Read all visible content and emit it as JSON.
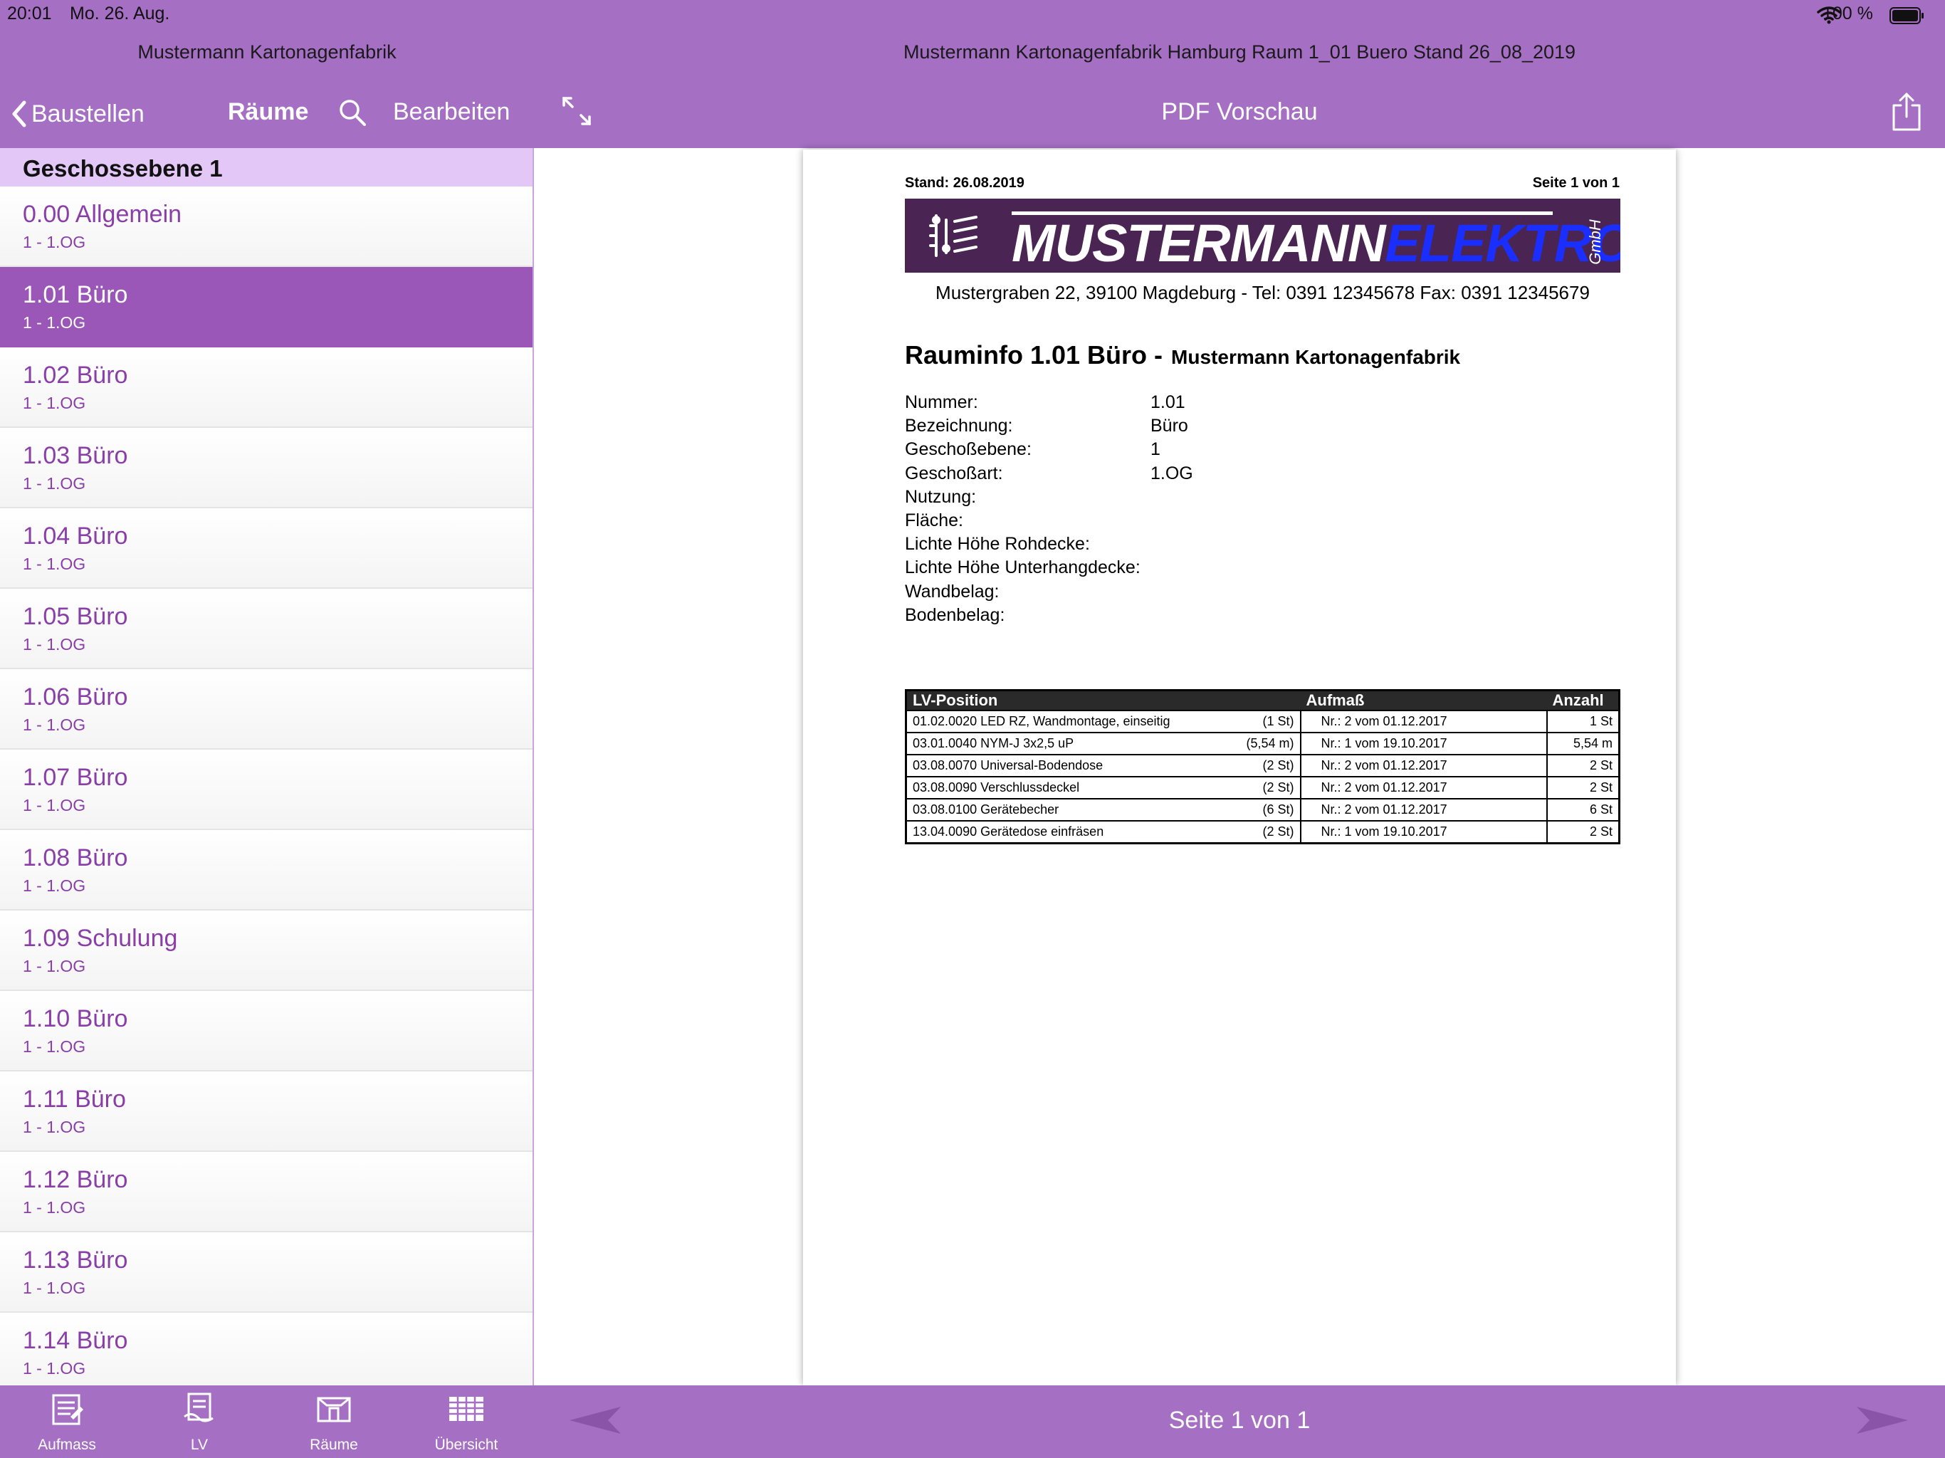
{
  "status_bar": {
    "time": "20:01",
    "date": "Mo. 26. Aug.",
    "battery": "100 %"
  },
  "left_panel": {
    "title": "Mustermann Kartonagenfabrik",
    "back_label": "Baustellen",
    "nav_title": "Räume",
    "edit_label": "Bearbeiten",
    "section": "Geschossebene 1",
    "rooms": [
      {
        "name": "0.00 Allgemein",
        "sub": "1 - 1.OG"
      },
      {
        "name": "1.01 Büro",
        "sub": "1 - 1.OG"
      },
      {
        "name": "1.02 Büro",
        "sub": "1 - 1.OG"
      },
      {
        "name": "1.03 Büro",
        "sub": "1 - 1.OG"
      },
      {
        "name": "1.04 Büro",
        "sub": "1 - 1.OG"
      },
      {
        "name": "1.05 Büro",
        "sub": "1 - 1.OG"
      },
      {
        "name": "1.06 Büro",
        "sub": "1 - 1.OG"
      },
      {
        "name": "1.07 Büro",
        "sub": "1 - 1.OG"
      },
      {
        "name": "1.08 Büro",
        "sub": "1 - 1.OG"
      },
      {
        "name": "1.09 Schulung",
        "sub": "1 - 1.OG"
      },
      {
        "name": "1.10 Büro",
        "sub": "1 - 1.OG"
      },
      {
        "name": "1.11 Büro",
        "sub": "1 - 1.OG"
      },
      {
        "name": "1.12 Büro",
        "sub": "1 - 1.OG"
      },
      {
        "name": "1.13 Büro",
        "sub": "1 - 1.OG"
      },
      {
        "name": "1.14 Büro",
        "sub": "1 - 1.OG"
      }
    ],
    "selected_room": "1.01 Büro",
    "tabs": [
      {
        "label": "Aufmass",
        "icon": "measurement-doc-icon"
      },
      {
        "label": "LV",
        "icon": "lv-doc-icon"
      },
      {
        "label": "Räume",
        "icon": "rooms-icon"
      },
      {
        "label": "Übersicht",
        "icon": "overview-grid-icon"
      }
    ]
  },
  "right_panel": {
    "title": "Mustermann Kartonagenfabrik Hamburg Raum 1_01 Buero Stand 26_08_2019",
    "nav_title": "PDF Vorschau",
    "page_indicator": "Seite 1 von 1"
  },
  "pdf": {
    "stand": "Stand: 26.08.2019",
    "seite": "Seite 1 von 1",
    "logo": {
      "part1": "MUSTERMANN",
      "part2": "ELEKTRO",
      "suffix": "GmbH"
    },
    "address": "Mustergraben 22, 39100 Magdeburg  -  Tel: 0391 12345678 Fax: 0391 12345679",
    "heading": "Rauminfo 1.01 Büro -",
    "client": "Mustermann Kartonagenfabrik",
    "properties": [
      {
        "label": "Nummer:",
        "value": "1.01"
      },
      {
        "label": "Bezeichnung:",
        "value": "Büro"
      },
      {
        "label": "Geschoßebene:",
        "value": "1"
      },
      {
        "label": "Geschoßart:",
        "value": "1.OG"
      },
      {
        "label": "Nutzung:",
        "value": ""
      },
      {
        "label": "Fläche:",
        "value": ""
      },
      {
        "label": "Lichte Höhe Rohdecke:",
        "value": ""
      },
      {
        "label": "Lichte Höhe Unterhangdecke:",
        "value": ""
      },
      {
        "label": "Wandbelag:",
        "value": ""
      },
      {
        "label": "Bodenbelag:",
        "value": ""
      }
    ],
    "table": {
      "headers": [
        "LV-Position",
        "Aufmaß",
        "Anzahl"
      ],
      "rows": [
        {
          "position": "01.02.0020 LED RZ, Wandmontage, einseitig",
          "qty": "(1 St)",
          "aufmass": "Nr.: 2 vom 01.12.2017",
          "anzahl": "1 St"
        },
        {
          "position": "03.01.0040 NYM-J 3x2,5 uP",
          "qty": "(5,54 m)",
          "aufmass": "Nr.: 1 vom 19.10.2017",
          "anzahl": "5,54 m"
        },
        {
          "position": "03.08.0070 Universal-Bodendose",
          "qty": "(2 St)",
          "aufmass": "Nr.: 2 vom 01.12.2017",
          "anzahl": "2 St"
        },
        {
          "position": "03.08.0090 Verschlussdeckel",
          "qty": "(2 St)",
          "aufmass": "Nr.: 2 vom 01.12.2017",
          "anzahl": "2 St"
        },
        {
          "position": "03.08.0100 Gerätebecher",
          "qty": "(6 St)",
          "aufmass": "Nr.: 2 vom 01.12.2017",
          "anzahl": "6 St"
        },
        {
          "position": "13.04.0090 Gerätedose einfräsen",
          "qty": "(2 St)",
          "aufmass": "Nr.: 1 vom 19.10.2017",
          "anzahl": "2 St"
        }
      ]
    }
  },
  "colors": {
    "accent": "#a56fc4",
    "selected": "#9a57b8",
    "section": "#e3c8f7",
    "text_purple": "#8a3ea8"
  }
}
